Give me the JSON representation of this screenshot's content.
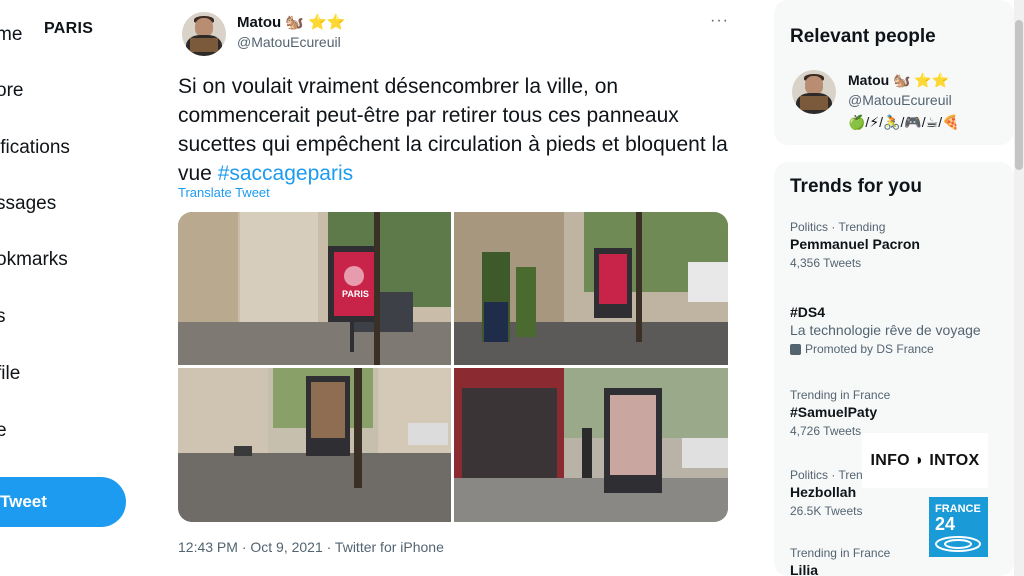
{
  "nav": {
    "location": "PARIS",
    "items": [
      "me",
      "ore",
      "ifications",
      "ssages",
      "okmarks",
      "s",
      "file",
      "e"
    ],
    "tweet_button": "Tweet"
  },
  "tweet": {
    "author_name": "Matou 🐿️ ⭐⭐",
    "handle": "@MatouEcureuil",
    "more": "···",
    "text_main": "Si on voulait vraiment désencombrer la ville, on commencerait peut-être par retirer tous ces panneaux sucettes qui empêchent la circulation à pieds et bloquent la vue ",
    "hashtag": "#saccageparis",
    "translate": "Translate Tweet",
    "poster_text": "PARIS",
    "timestamp": "12:43 PM · Oct 9, 2021 · Twitter for iPhone"
  },
  "sidebar": {
    "relevant": {
      "title": "Relevant people",
      "name": "Matou 🐿️ ⭐⭐",
      "handle": "@MatouEcureuil",
      "bio": "🍏/⚡/🚴/🎮/☕/🍕"
    },
    "trends": {
      "title": "Trends for you",
      "items": [
        {
          "meta": "Politics · Trending",
          "name": "Pemmanuel Pacron",
          "count": "4,356 Tweets"
        },
        {
          "meta": "",
          "name": "#DS4",
          "desc": "La technologie rêve de voyage",
          "promo": "Promoted by DS France"
        },
        {
          "meta": "Trending in France",
          "name": "#SamuelPaty",
          "count": "4,726 Tweets"
        },
        {
          "meta": "Politics · Trending",
          "name": "Hezbollah",
          "count": "26.5K Tweets"
        },
        {
          "meta": "Trending in France",
          "name": "Lilia"
        }
      ]
    }
  },
  "overlay": {
    "info_intox": "INFO ◗ INTOX",
    "france24_top": "FRANCE",
    "france24_num": "24"
  },
  "colors": {
    "accent": "#1d9bf0",
    "text": "#0f1419",
    "muted": "#536471",
    "france24": "#1a9ad6"
  }
}
